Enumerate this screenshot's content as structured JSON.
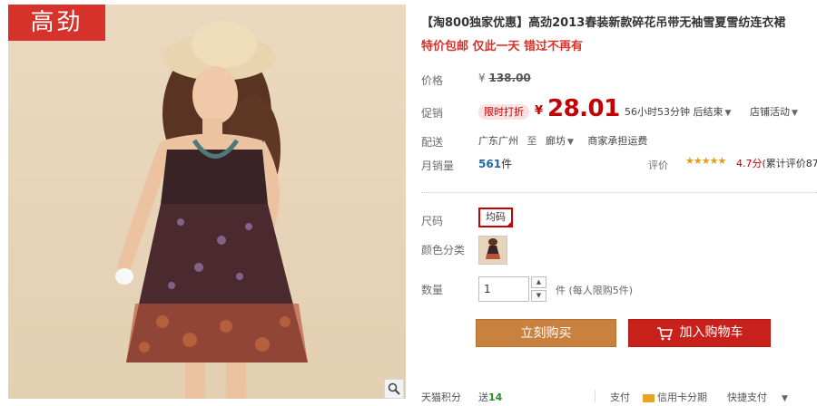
{
  "photo": {
    "brand_badge": "高劲",
    "zoom_icon": "magnifier-icon"
  },
  "product": {
    "title": "【淘800独家优惠】高劲2013春装新款碎花吊带无袖雪夏雪纺连衣裙",
    "subtitle": "特价包邮 仅此一天 错过不再有"
  },
  "price": {
    "label": "价格",
    "yen": "¥",
    "original": "138.00"
  },
  "promo": {
    "label": "促销",
    "badge": "限时打折",
    "yen": "¥",
    "price": "28.01",
    "countdown": "56小时53分钟 后结束",
    "store_activity": "店铺活动"
  },
  "shipping": {
    "label": "配送",
    "from": "广东广州",
    "to_word": "至",
    "to": "廊坊",
    "fee": "商家承担运费"
  },
  "sales": {
    "label": "月销量",
    "count": "561",
    "unit": "件",
    "review_label": "评价",
    "stars": "★★★★★",
    "score": "4.7分",
    "total": "(累计评价87"
  },
  "options": {
    "size_label": "尺码",
    "size_value": "均码",
    "color_label": "颜色分类"
  },
  "quantity": {
    "label": "数量",
    "value": "1",
    "note": "件 (每人限购5件)"
  },
  "actions": {
    "buy_now": "立刻购买",
    "add_to_cart": "加入购物车"
  },
  "bottom": {
    "points_label": "天猫积分",
    "points_prefix": "送",
    "points_value": "14",
    "pay_label": "支付",
    "credit_card": "信用卡分期",
    "quick_pay": "快捷支付"
  },
  "colors": {
    "brand_red": "#d7322b",
    "price_red": "#c40000",
    "buy_button": "#c8813f",
    "cart_button": "#c8211b"
  }
}
